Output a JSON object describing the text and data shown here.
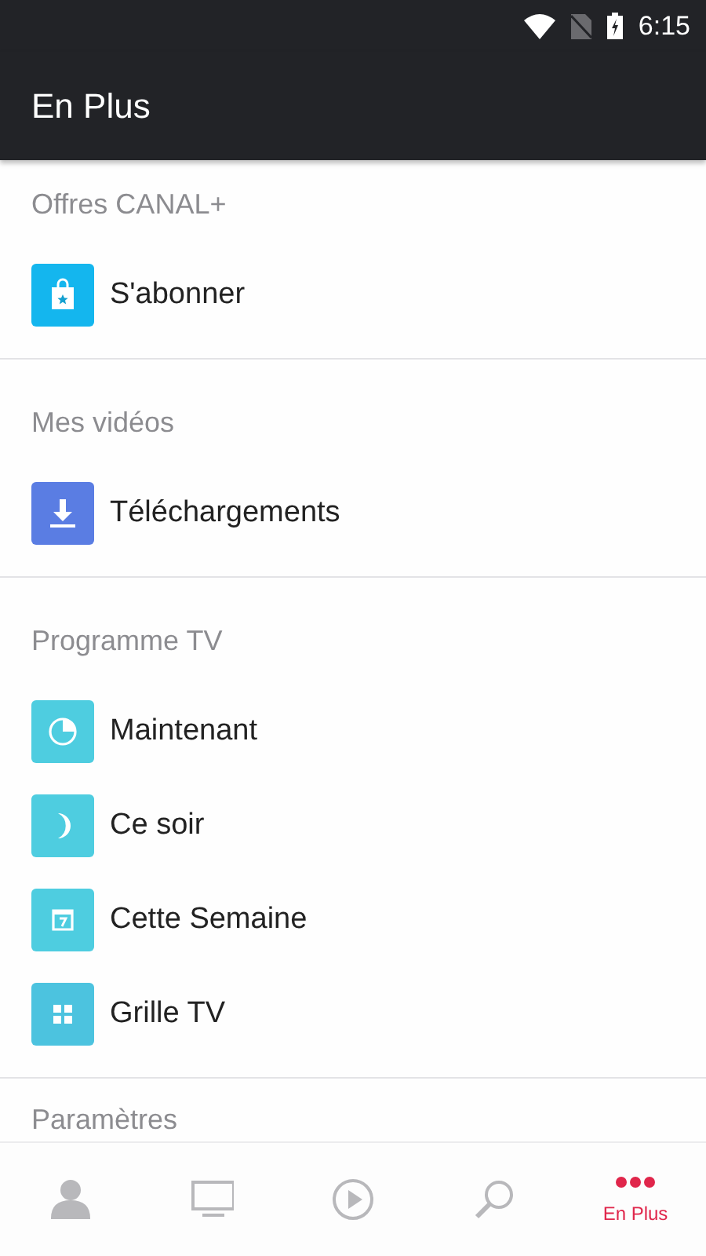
{
  "status_bar": {
    "time": "6:15"
  },
  "app_bar": {
    "title": "En Plus"
  },
  "sections": [
    {
      "title": "Offres CANAL+",
      "items": [
        {
          "label": "S'abonner",
          "kind": "shop",
          "color": "#14b6ee"
        }
      ]
    },
    {
      "title": "Mes vidéos",
      "items": [
        {
          "label": "Téléchargements",
          "kind": "download",
          "color": "#5a7de3"
        }
      ]
    },
    {
      "title": "Programme TV",
      "items": [
        {
          "label": "Maintenant",
          "kind": "clock",
          "color": "#4ecde0"
        },
        {
          "label": "Ce soir",
          "kind": "moon",
          "color": "#4ecde0"
        },
        {
          "label": "Cette Semaine",
          "kind": "calendar",
          "color": "#4ecde0"
        },
        {
          "label": "Grille TV",
          "kind": "grid",
          "color": "#4cc3df"
        }
      ]
    },
    {
      "title": "Paramètres"
    }
  ],
  "bottom_nav": [
    {
      "kind": "profile",
      "selected": false
    },
    {
      "kind": "tv",
      "selected": false
    },
    {
      "kind": "play",
      "selected": false
    },
    {
      "kind": "search",
      "selected": false
    },
    {
      "kind": "more",
      "selected": true,
      "label": "En Plus"
    }
  ]
}
